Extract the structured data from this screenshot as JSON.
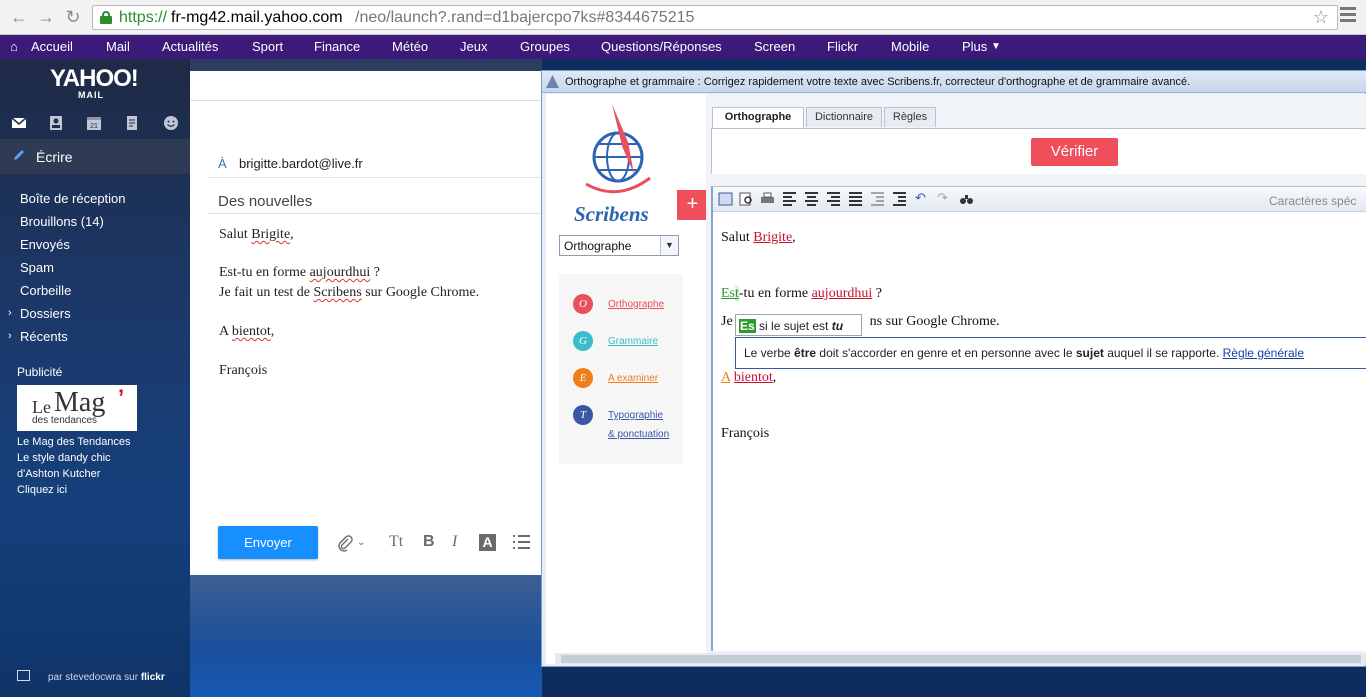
{
  "browser": {
    "url_scheme": "https://",
    "url_host": "fr-mg42.mail.yahoo.com",
    "url_path": "/neo/launch?.rand=d1bajercpo7ks#8344675215"
  },
  "yahoo_nav": {
    "items": [
      "Accueil",
      "Mail",
      "Actualités",
      "Sport",
      "Finance",
      "Météo",
      "Jeux",
      "Groupes",
      "Questions/Réponses",
      "Screen",
      "Flickr",
      "Mobile",
      "Plus"
    ]
  },
  "sidebar": {
    "logo": "YAHOO!",
    "logo_sub": "MAIL",
    "compose_label": "Écrire",
    "folders": [
      "Boîte de réception",
      "Brouillons (14)",
      "Envoyés",
      "Spam",
      "Corbeille",
      "Dossiers",
      "Récents"
    ],
    "ad": {
      "title": "Publicité",
      "logo_le": "Le",
      "logo_mag": "Mag",
      "logo_apos": "’",
      "logo_sub": "des tendances",
      "lines": [
        "Le Mag des Tendances",
        "Le style dandy chic",
        "d'Ashton Kutcher",
        "Cliquez ici"
      ]
    },
    "photo_credit_prefix": "par stevedocwra sur",
    "photo_credit_brand": "flickr"
  },
  "compose": {
    "to_label": "À",
    "to_value": "brigitte.bardot@live.fr",
    "subject": "Des nouvelles",
    "body": {
      "l1_a": "Salut ",
      "l1_b": "Brigite",
      "l1_c": ",",
      "l2_a": "Est-tu en forme ",
      "l2_b": "aujourdhui",
      "l2_c": " ?",
      "l3_a": "Je fait un test de ",
      "l3_b": "Scribens",
      "l3_c": " sur Google Chrome.",
      "l4_a": "A ",
      "l4_b": "bientot",
      "l4_c": ",",
      "l5": "François"
    },
    "send_label": "Envoyer",
    "tools": {
      "font": "Tt",
      "bold": "B",
      "italic": "I",
      "color": "A"
    }
  },
  "scribens": {
    "window_title": "Orthographe et grammaire : Corrigez rapidement votre texte avec Scribens.fr, correcteur d'orthographe et de grammaire avancé.",
    "logo_text": "Scribens",
    "plus_label": "+",
    "select_value": "Orthographe",
    "menu": [
      {
        "letter": "O",
        "label": "Orthographe",
        "color": "#e8505b"
      },
      {
        "letter": "G",
        "label": "Grammaire",
        "color": "#3bbdc9"
      },
      {
        "letter": "E",
        "label": "A examiner",
        "color": "#ef7d1a"
      },
      {
        "letter": "T",
        "label": "Typographie",
        "label2": "& ponctuation",
        "color": "#3a57a7"
      }
    ],
    "tabs": [
      "Orthographe",
      "Dictionnaire",
      "Règles"
    ],
    "verify_label": "Vérifier",
    "char_spec": "Caractères spéc",
    "editor": {
      "l1_a": "Salut ",
      "l1_b": "Brigite",
      "l1_c": ",",
      "l2_a": "Es",
      "l2_b": "t",
      "l2_c": "-tu en forme ",
      "l2_d": "aujourdhui",
      "l2_e": " ?",
      "l3_a": "Je",
      "l3_b": "ns sur Google Chrome.",
      "l4_a": "A",
      "l4_b": " ",
      "l4_c": "bientot",
      "l4_d": ",",
      "l5": "François"
    },
    "tip_small": {
      "badge": "Es",
      "text": " si le sujet est ",
      "bold": "tu"
    },
    "tip_big": {
      "t1": "Le verbe ",
      "b1": "être",
      "t2": " doit s'accorder en genre et en personne avec le ",
      "b2": "sujet",
      "t3": " auquel il se rapporte. ",
      "link": "Règle générale"
    }
  },
  "colors": {
    "yahoo_purple": "#3b1a7a",
    "scribens_red": "#ef4e5b",
    "send_blue": "#188fff",
    "error_red": "#c8102e",
    "grammar_green": "#2b9b2b"
  }
}
